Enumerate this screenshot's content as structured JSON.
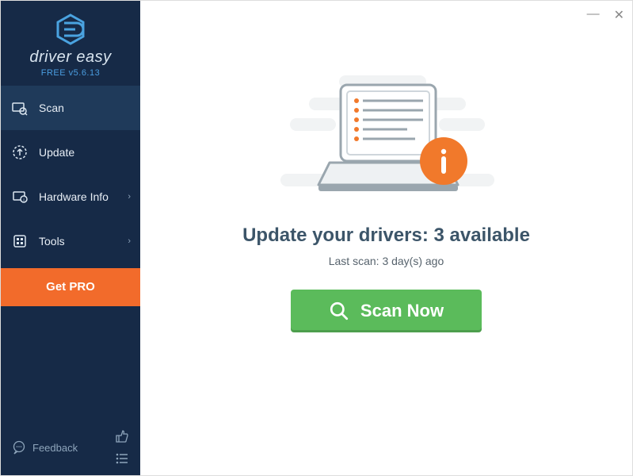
{
  "brand": {
    "name": "driver easy",
    "version": "FREE v5.6.13"
  },
  "sidebar": {
    "items": [
      {
        "label": "Scan",
        "icon": "scan-icon",
        "active": true,
        "expandable": false
      },
      {
        "label": "Update",
        "icon": "update-icon",
        "active": false,
        "expandable": false
      },
      {
        "label": "Hardware Info",
        "icon": "hardware-icon",
        "active": false,
        "expandable": true
      },
      {
        "label": "Tools",
        "icon": "tools-icon",
        "active": false,
        "expandable": true
      }
    ],
    "getpro_label": "Get PRO",
    "feedback_label": "Feedback"
  },
  "titlebar": {
    "minimize": "—",
    "close": "✕"
  },
  "main": {
    "headline_prefix": "Update your drivers: ",
    "available_count": 3,
    "headline_suffix": " available",
    "last_scan_prefix": "Last scan: ",
    "last_scan_value": "3 day(s) ago",
    "scan_button": "Scan Now"
  },
  "colors": {
    "sidebar_bg": "#162a47",
    "accent_orange": "#f26b2b",
    "accent_green": "#5bbb5b",
    "info_circle": "#f1792b",
    "headline": "#3c5569"
  }
}
